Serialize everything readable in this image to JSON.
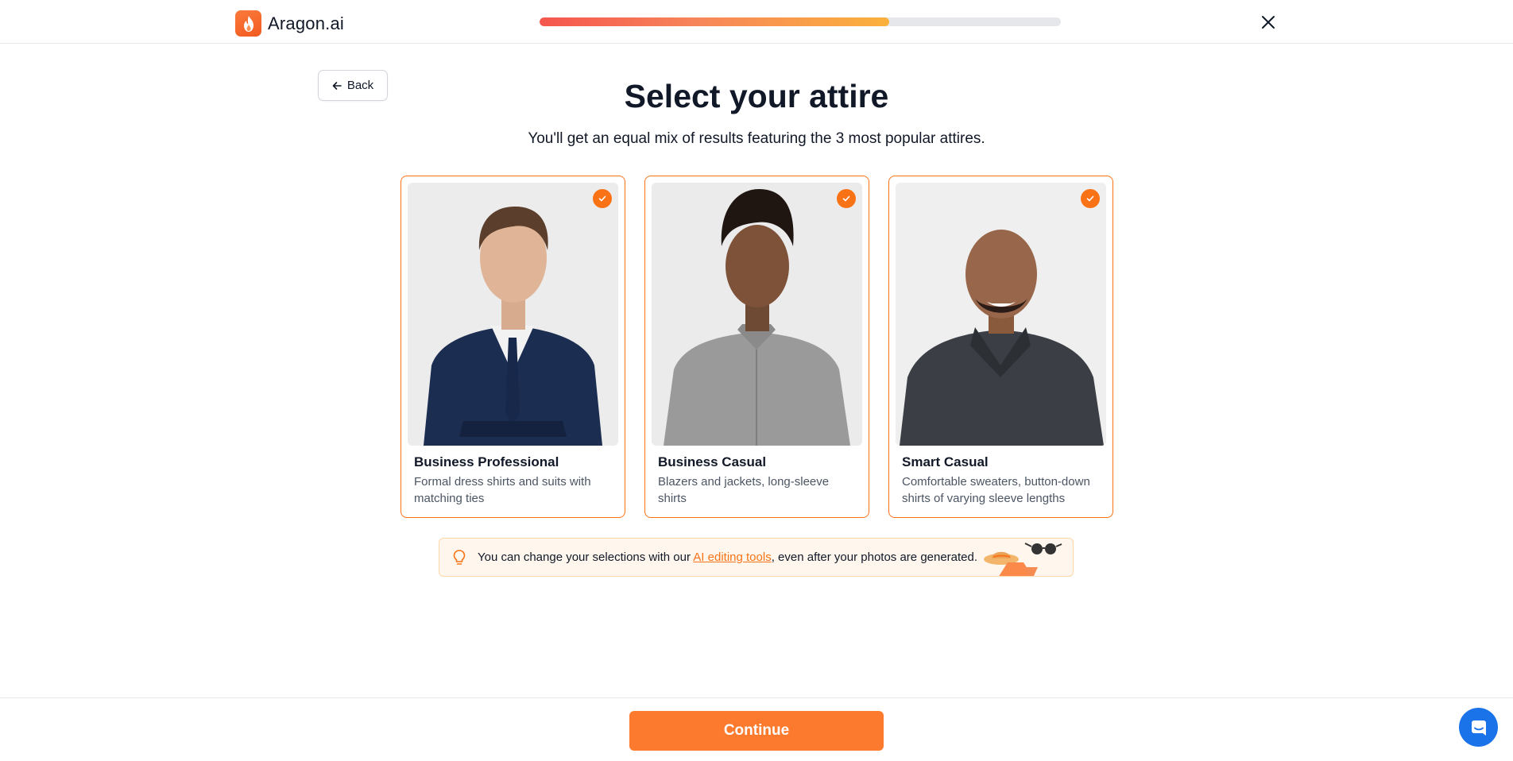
{
  "header": {
    "brand": "Aragon.ai",
    "progress_fraction": 0.67
  },
  "back_label": "Back",
  "title": "Select your attire",
  "subtitle": "You'll get an equal mix of results featuring the 3 most popular attires.",
  "attires": [
    {
      "title": "Business Professional",
      "description": "Formal dress shirts and suits with matching ties",
      "selected": true
    },
    {
      "title": "Business Casual",
      "description": "Blazers and jackets, long-sleeve shirts",
      "selected": true
    },
    {
      "title": "Smart Casual",
      "description": "Comfortable sweaters, button-down shirts of varying sleeve lengths",
      "selected": true
    }
  ],
  "tip": {
    "before": "You can change your selections with our ",
    "link": "AI editing tools",
    "after": ", even after your photos are generated."
  },
  "continue_label": "Continue",
  "colors": {
    "accent": "#f97316",
    "button": "#fb7a2e",
    "chat": "#1a73e8"
  },
  "icons": [
    "flame-icon",
    "close-icon",
    "arrow-left-icon",
    "check-icon",
    "lightbulb-icon",
    "chat-icon"
  ]
}
